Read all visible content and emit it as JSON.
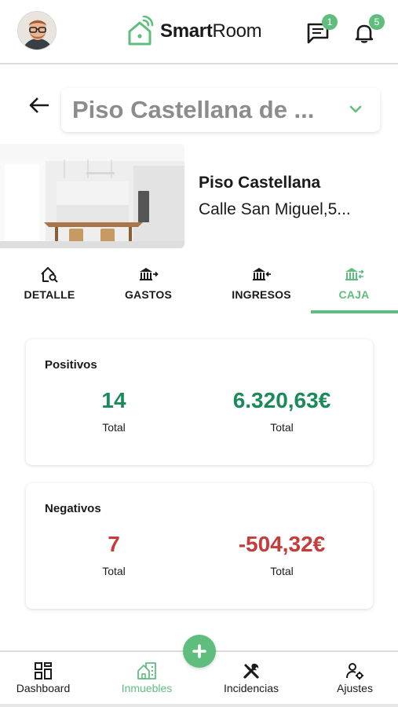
{
  "header": {
    "logo_bold": "Smart",
    "logo_regular": "Room",
    "messages_badge": "1",
    "notifications_badge": "5"
  },
  "property_selector": {
    "value": "Piso Castellana de ..."
  },
  "property": {
    "name": "Piso Castellana",
    "address": "Calle San Miguel,5..."
  },
  "tabs": [
    {
      "label": "DETALLE",
      "icon": "house-search-icon"
    },
    {
      "label": "GASTOS",
      "icon": "bank-out-icon"
    },
    {
      "label": "INGRESOS",
      "icon": "bank-in-icon"
    },
    {
      "label": "CAJA",
      "icon": "bank-transfer-icon",
      "active": true
    }
  ],
  "positivos": {
    "title": "Positivos",
    "count": "14",
    "count_label": "Total",
    "amount": "6.320,63€",
    "amount_label": "Total"
  },
  "negativos": {
    "title": "Negativos",
    "count": "7",
    "count_label": "Total",
    "amount": "-504,32€",
    "amount_label": "Total"
  },
  "nav": [
    {
      "label": "Dashboard",
      "icon": "grid-icon"
    },
    {
      "label": "Inmuebles",
      "icon": "buildings-icon",
      "active": true
    },
    {
      "label": "Incidencias",
      "icon": "tools-icon"
    },
    {
      "label": "Ajustes",
      "icon": "user-settings-icon"
    }
  ],
  "colors": {
    "accent": "#5fbe7e",
    "positive": "#1b8a5a",
    "negative": "#c73b3b"
  }
}
